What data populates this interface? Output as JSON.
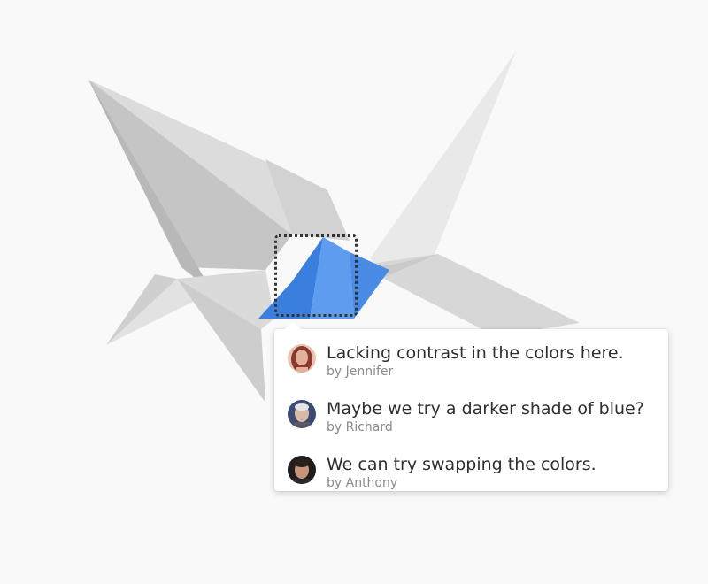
{
  "colors": {
    "background": "#f9f9f9",
    "highlight_blue": "#4d90e8",
    "crane_light": "#e8e8e8",
    "crane_mid": "#d6d6d6",
    "crane_dark": "#bdbdbd"
  },
  "comments": [
    {
      "text": "Lacking contrast in the colors here.",
      "author": "by Jennifer",
      "avatar": "avatar-jennifer"
    },
    {
      "text": "Maybe we try a darker shade of blue?",
      "author": "by Richard",
      "avatar": "avatar-richard"
    },
    {
      "text": "We can try swapping the colors.",
      "author": "by Anthony",
      "avatar": "avatar-anthony"
    }
  ]
}
